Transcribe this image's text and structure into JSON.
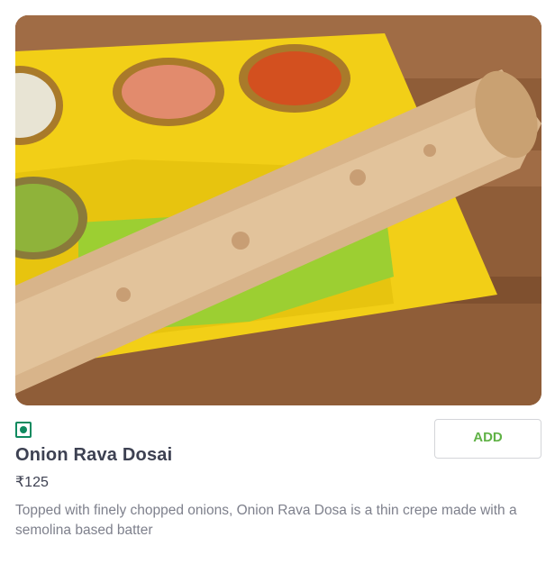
{
  "item": {
    "name": "Onion Rava Dosai",
    "price": "₹125",
    "description": "Topped with finely chopped onions, Onion Rava Dosa is a thin crepe made with a semolina based batter",
    "veg_indicator_color": "#0f8a5f"
  },
  "actions": {
    "add_label": "ADD",
    "add_color": "#60b246"
  }
}
